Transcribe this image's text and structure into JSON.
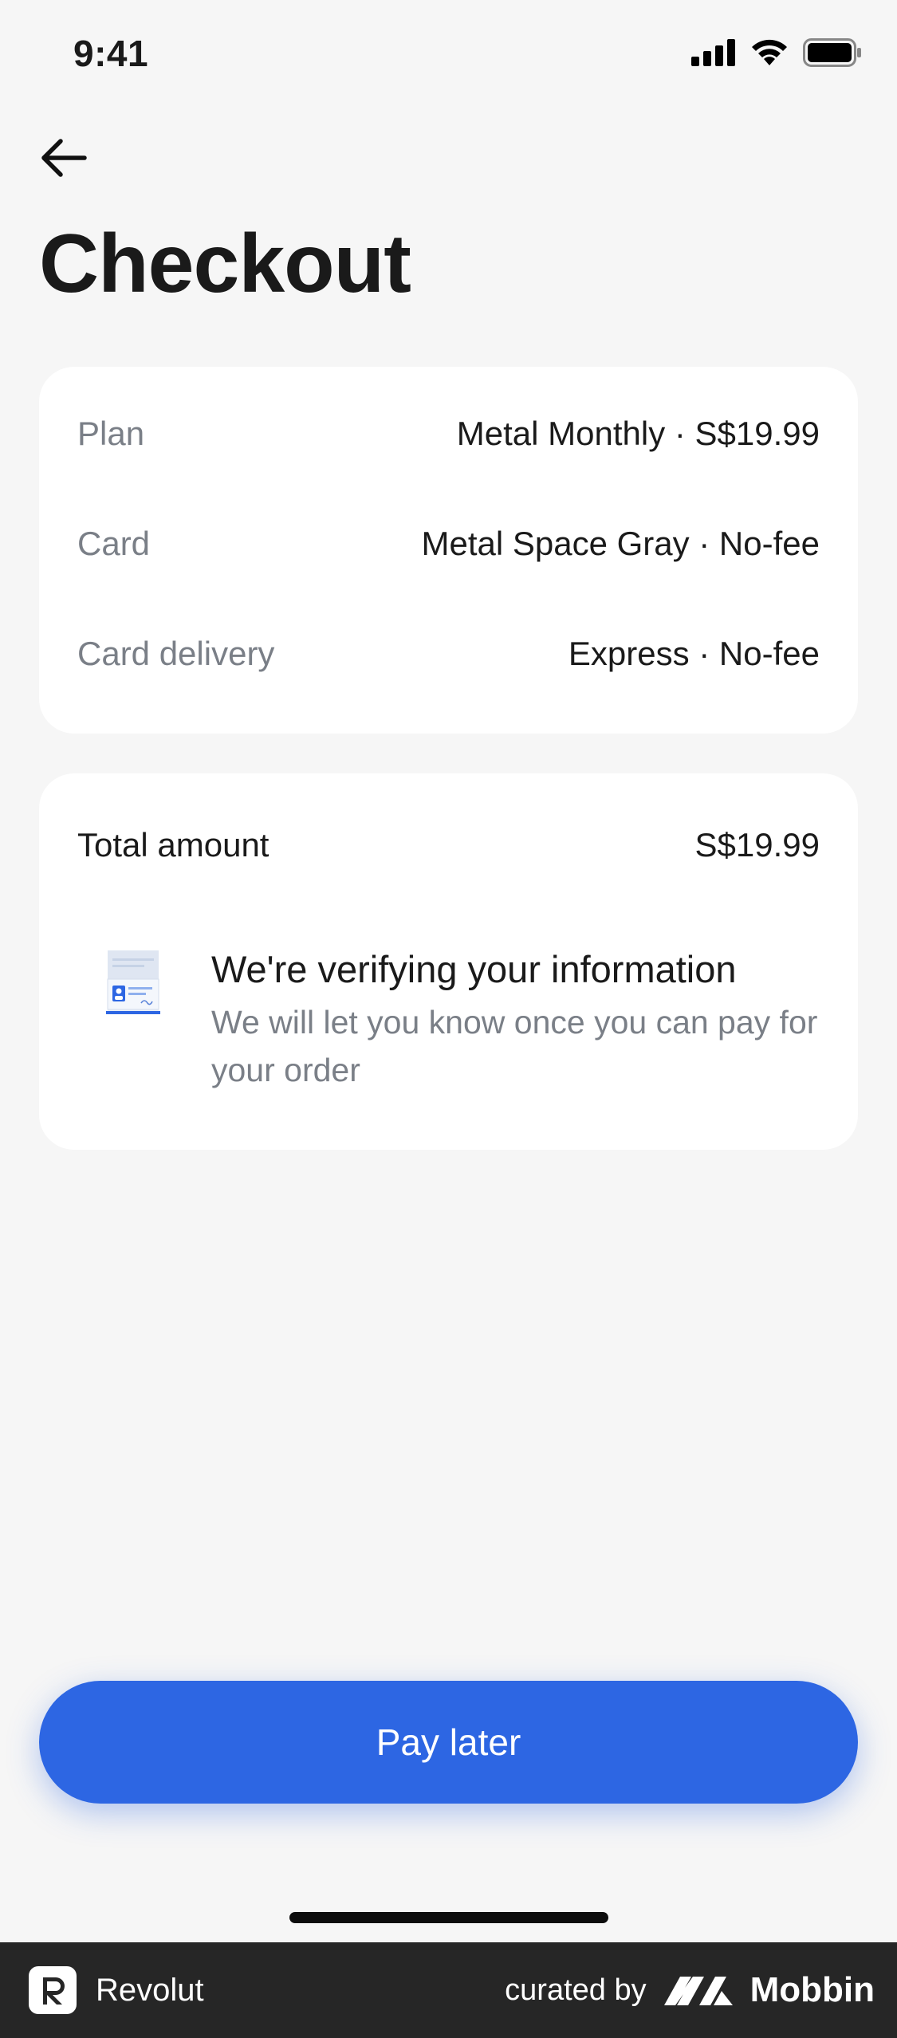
{
  "status_bar": {
    "time": "9:41"
  },
  "header": {
    "title": "Checkout"
  },
  "details": [
    {
      "label": "Plan",
      "value": "Metal Monthly · S$19.99"
    },
    {
      "label": "Card",
      "value": "Metal Space Gray · No-fee"
    },
    {
      "label": "Card delivery",
      "value": "Express · No-fee"
    }
  ],
  "total": {
    "label": "Total amount",
    "value": "S$19.99"
  },
  "verification": {
    "title": "We're verifying your information",
    "subtitle": "We will let you know once you can pay for your order",
    "icon": "id-document-icon"
  },
  "actions": {
    "pay_label": "Pay later"
  },
  "footer": {
    "brand": "Revolut",
    "curated_by": "curated by",
    "curator": "Mobbin"
  },
  "colors": {
    "accent": "#2d66e3",
    "background": "#f6f6f6",
    "muted_text": "#7a7f87"
  }
}
